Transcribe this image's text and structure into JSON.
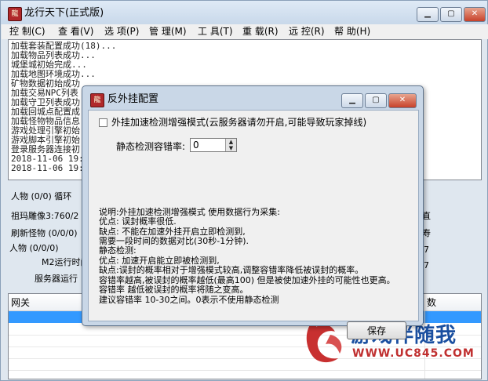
{
  "window": {
    "title": "龙行天下(正式版)",
    "menu": [
      "控 制(C)",
      "查 看(V)",
      "选 项(P)",
      "管 理(M)",
      "工 具(T)",
      "重 载(R)",
      "远 控(R)",
      "帮 助(H)"
    ]
  },
  "log_lines": [
    "加载套装配置成功(18)...",
    "加载物品列表成功...",
    "城堡城初始完成...",
    "加载地图环境成功...",
    "矿物数据初始成功",
    "加载交易NPC列表",
    "加载守卫列表成功",
    "加载回城点配置成",
    "加载怪物物品信息",
    "游戏处理引擎初始",
    "游戏脚本引擎初始",
    "登录服务器连接初",
    "2018-11-06 19:30",
    "2018-11-06 19:30"
  ],
  "stats": {
    "line1": "人物 (0/0)  循环",
    "line2": "祖玛雕像3:760/2",
    "line3": "刷新怪物 (0/0/0)",
    "line4": "人物 (0/0/0)",
    "line5": "M2运行时间",
    "line6": "服务器运行",
    "right1": "直",
    "right2": "寿",
    "right3": "7",
    "right4": "7"
  },
  "table": {
    "col_gateway": "网关",
    "col_count": "数"
  },
  "watermark": {
    "text": "游戏伴随我",
    "url": "WWW.UC845.COM"
  },
  "dialog": {
    "title": "反外挂配置",
    "checkbox_label": "外挂加速检测增强模式(云服务器请勿开启,可能导致玩家掉线)",
    "checkbox_checked": false,
    "field_label": "静态检测容错率:",
    "field_value": "0",
    "desc": [
      "说明:外挂加速检测增强模式 使用数据行为采集:",
      "优点: 误封概率很低.",
      "缺点: 不能在加速外挂开启立即检测到,",
      "需要一段时间的数据对比(30秒-1分钟).",
      "静态检测:",
      "优点: 加速开启能立即被检测到,",
      "缺点:误封的概率相对于增强模式较高,调整容错率降低被误封的概率。",
      "容错率越高,被误封的概率越低(最高100) 但是被使加速外挂的可能性也更高。",
      "容错率 越低被误封的概率将随之变高。",
      " 建议容错率 10-30之间。0表示不使用静态检测"
    ],
    "save_label": "保存"
  }
}
